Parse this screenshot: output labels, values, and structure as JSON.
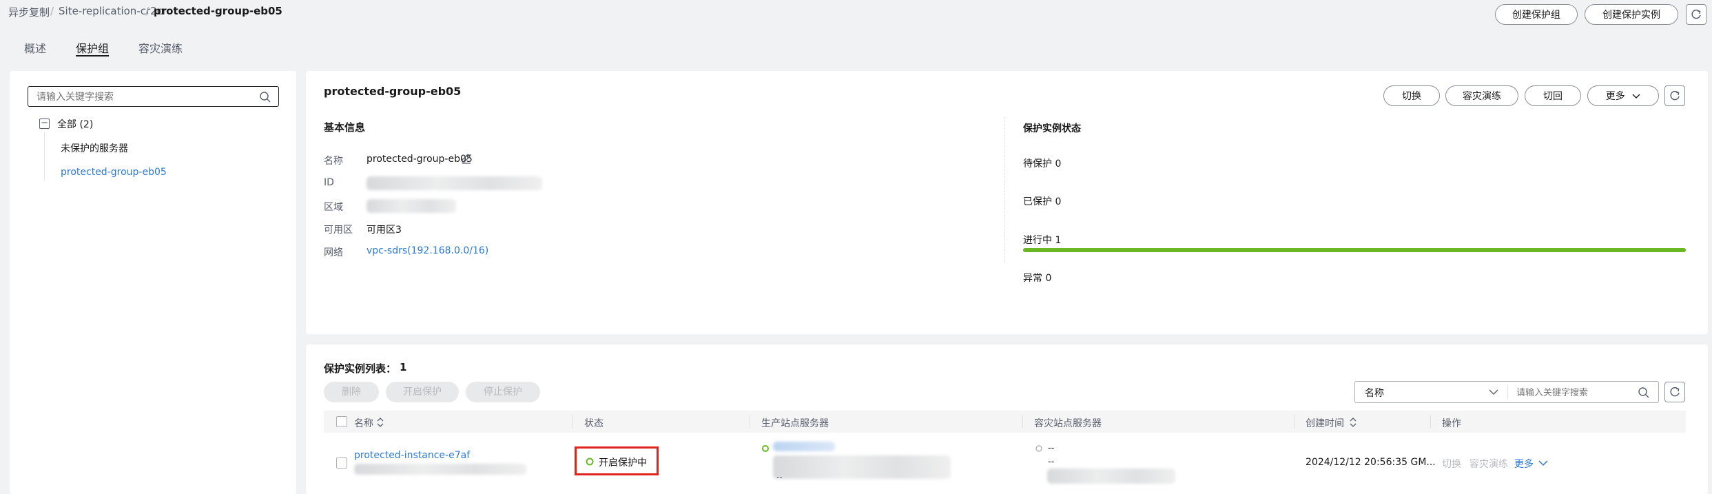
{
  "breadcrumb": {
    "item1": "异步复制",
    "item2": "Site-replication-cr2cr",
    "item3": "protected-group-eb05",
    "sep": "/"
  },
  "header": {
    "create_group": "创建保护组",
    "create_instance": "创建保护实例"
  },
  "tabs": [
    "概述",
    "保护组",
    "容灾演练"
  ],
  "sidebar": {
    "search_placeholder": "请输入关键字搜索",
    "tree_root": "全部 (2)",
    "tree_collapse": "−",
    "items": [
      "未保护的服务器",
      "protected-group-eb05"
    ]
  },
  "detail": {
    "title": "protected-group-eb05",
    "actions": {
      "switch": "切换",
      "drill": "容灾演练",
      "failback": "切回",
      "more": "更多"
    },
    "basic": {
      "heading": "基本信息",
      "name_label": "名称",
      "name_value": "protected-group-eb05",
      "id_label": "ID",
      "region_label": "区域",
      "az_label": "可用区",
      "az_value": "可用区3",
      "network_label": "网络",
      "network_value": "vpc-sdrs(192.168.0.0/16)"
    },
    "status": {
      "heading": "保护实例状态",
      "pending": "待保护 0",
      "protected": "已保护 0",
      "in_progress": "进行中 1",
      "in_progress_fraction": 1.0,
      "abnormal": "异常 0"
    }
  },
  "instances": {
    "title": "保护实例列表：",
    "count": "1",
    "buttons": {
      "delete": "删除",
      "start": "开启保护",
      "stop": "停止保护"
    },
    "filter_field": "名称",
    "search_placeholder": "请输入关键字搜索",
    "columns": [
      "名称",
      "状态",
      "生产站点服务器",
      "容灾站点服务器",
      "创建时间",
      "操作"
    ],
    "rows": [
      {
        "name": "protected-instance-e7af",
        "status": "开启保护中",
        "dr_dash1": "--",
        "dr_dash2": "--",
        "prod_dash": "--",
        "created": "2024/12/12 20:56:35 GM...",
        "op_switch": "切换",
        "op_drill": "容灾演练",
        "op_more": "更多"
      }
    ]
  },
  "colors": {
    "accent": "#2a79d8",
    "success": "#6ab824",
    "highlight_box": "#e0241b"
  }
}
